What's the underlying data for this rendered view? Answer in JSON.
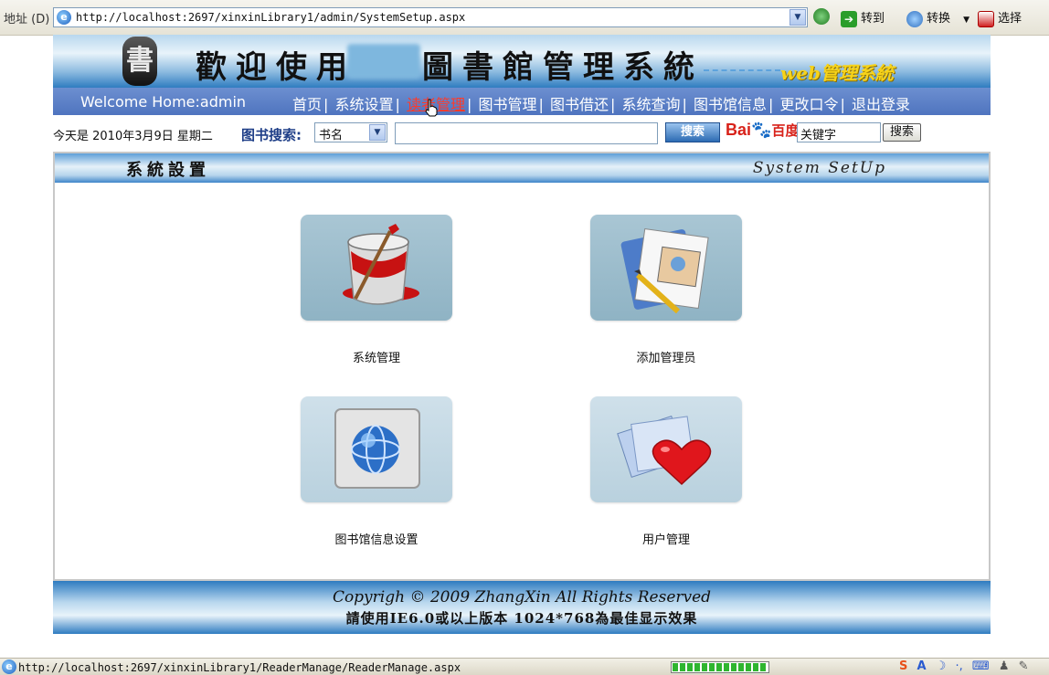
{
  "browser": {
    "address_label": "地址 (D)",
    "url": "http://localhost:2697/xinxinLibrary1/admin/SystemSetup.aspx",
    "go_label": "转到",
    "convert_label": "转换",
    "select_label": "选择"
  },
  "banner": {
    "title_left": "歡迎使用",
    "title_right": "圖書館管理系統",
    "subtitle": "web管理系統"
  },
  "nav": {
    "welcome": "Welcome Home:admin",
    "links": [
      "首页",
      "系统设置",
      "读者管理",
      "图书管理",
      "图书借还",
      "系统查询",
      "图书馆信息",
      "更改口令",
      "退出登录"
    ],
    "active_index": 2
  },
  "search": {
    "date_text": "今天是 2010年3月9日 星期二",
    "label": "图书搜索:",
    "field_selected": "书名",
    "keyword_value": "",
    "search_button": "搜索",
    "baidu_logo": "Bai 百度",
    "baidu_input_value": "关键字",
    "baidu_button": "搜索"
  },
  "panel": {
    "title": "系統設置",
    "title_en": "System SetUp",
    "tiles": [
      {
        "label": "系统管理",
        "icon": "paint-bucket-icon"
      },
      {
        "label": "添加管理员",
        "icon": "documents-pen-icon"
      },
      {
        "label": "图书馆信息设置",
        "icon": "globe-icon"
      },
      {
        "label": "用户管理",
        "icon": "heart-documents-icon"
      }
    ]
  },
  "footer": {
    "line1": "Copyrigh © 2009 ZhangXin   All Rights Reserved",
    "line2": "請使用IE6.0或以上版本  1024*768為最佳显示效果"
  },
  "status": {
    "url": "http://localhost:2697/xinxinLibrary1/ReaderManage/ReaderManage.aspx",
    "progress": 1.0
  },
  "colors": {
    "nav_bg": "#5a7fc6",
    "active_link": "#ff3a2a",
    "accent_blue": "#2e7bc0"
  }
}
